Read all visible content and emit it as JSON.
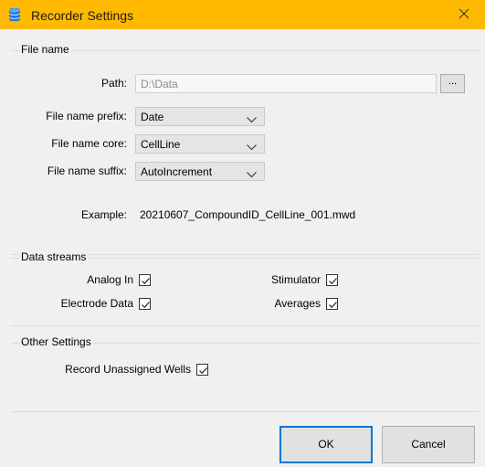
{
  "window": {
    "title": "Recorder Settings",
    "icon": "database-icon",
    "title_bar_color": "#ffb900",
    "close_icon": "close-icon"
  },
  "file_name": {
    "group_title": "File name",
    "path_label": "Path:",
    "path_value": "D:\\Data",
    "browse_label": "...",
    "prefix_label": "File name prefix:",
    "prefix_value": "Date",
    "core_label": "File name core:",
    "core_value": "CellLine",
    "suffix_label": "File name suffix:",
    "suffix_value": "AutoIncrement",
    "example_label": "Example:",
    "example_value": "20210607_CompoundID_CellLine_001.mwd"
  },
  "data_streams": {
    "group_title": "Data streams",
    "items": [
      {
        "label": "Analog In",
        "checked": true
      },
      {
        "label": "Electrode Data",
        "checked": true
      },
      {
        "label": "Stimulator",
        "checked": true
      },
      {
        "label": "Averages",
        "checked": true
      }
    ]
  },
  "other_settings": {
    "group_title": "Other Settings",
    "record_unassigned_label": "Record Unassigned Wells",
    "record_unassigned_checked": true
  },
  "buttons": {
    "ok_label": "OK",
    "cancel_label": "Cancel",
    "accent": "#0078d7"
  }
}
